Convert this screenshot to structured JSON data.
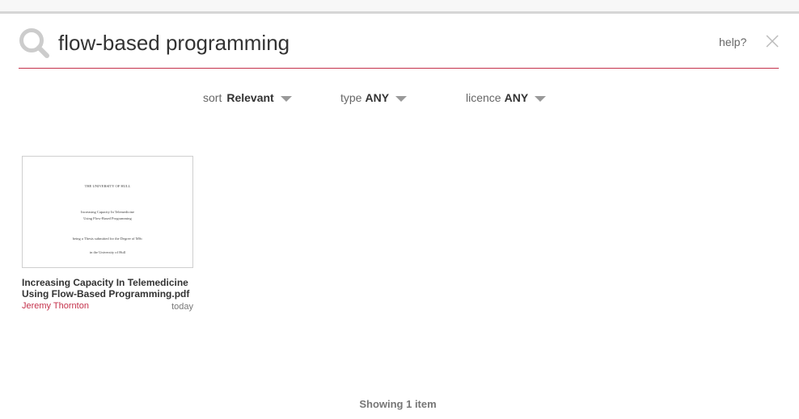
{
  "search": {
    "query": "flow-based programming",
    "help_label": "help?"
  },
  "filters": {
    "sort": {
      "label": "sort",
      "value": "Relevant"
    },
    "type": {
      "label": "type",
      "value": "ANY"
    },
    "licence": {
      "label": "licence",
      "value": "ANY"
    }
  },
  "results": [
    {
      "title": "Increasing Capacity In Telemedicine Using Flow-Based Programming.pdf",
      "author": "Jeremy Thornton",
      "date": "today",
      "thumbnail_lines": [
        "THE UNIVERSITY OF HULL",
        "Increasing Capacity In Telemedicine",
        "Using Flow-Based Programming",
        "being a Thesis submitted for the Degree of MSc",
        "in the University of Hull"
      ]
    }
  ],
  "footer": {
    "status": "Showing 1 item"
  },
  "colors": {
    "accent": "#c4314b",
    "icon_gray": "#cccccc"
  }
}
